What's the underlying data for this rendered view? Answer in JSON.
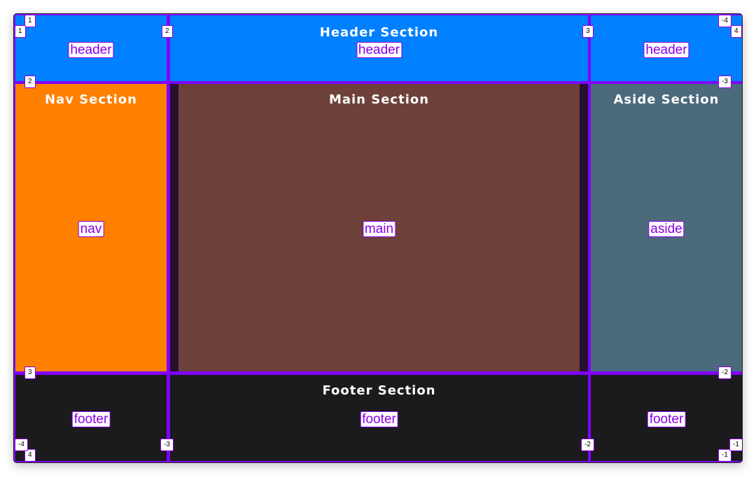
{
  "colors": {
    "grid_line": "#8000ff",
    "header": "#0080ff",
    "nav": "#ff7f00",
    "main": "#6d4139",
    "aside": "#4b6a7c",
    "footer": "#1b1b1d",
    "label": "#8a00e6"
  },
  "sections": {
    "header": "Header Section",
    "nav": "Nav Section",
    "main": "Main Section",
    "aside": "Aside Section",
    "footer": "Footer Section"
  },
  "areas": {
    "header": "header",
    "nav": "nav",
    "main": "main",
    "aside": "aside",
    "footer": "footer"
  },
  "line_numbers": {
    "col_pos": [
      "1",
      "2",
      "3",
      "4"
    ],
    "col_neg": [
      "-4",
      "-3",
      "-2",
      "-1"
    ],
    "row_pos": [
      "1",
      "2",
      "3",
      "4"
    ],
    "row_neg": [
      "-4",
      "-3",
      "-2",
      "-1"
    ]
  }
}
